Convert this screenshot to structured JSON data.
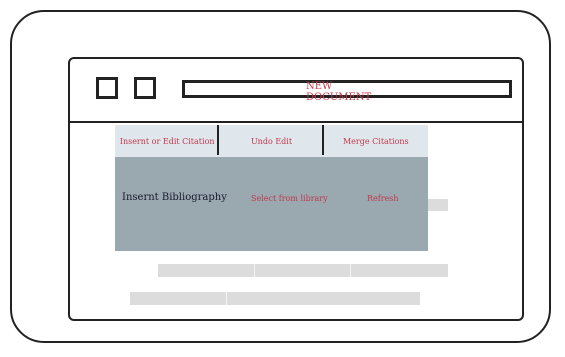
{
  "window": {
    "document_title": "NEW DOCUMENT"
  },
  "menu": {
    "row1": [
      {
        "label": "Insernt or Edit Citation"
      },
      {
        "label": "Undo Edit"
      },
      {
        "label": "Merge Citations"
      }
    ],
    "row2": {
      "insert_bibliography": "Insernt Bibliography",
      "select_from_library": "Select from library",
      "refresh": "Refresh"
    }
  },
  "colors": {
    "accent_text": "#c0394b",
    "menu_top_bg": "#dfe6ec",
    "menu_bottom_bg": "#9aa8b0",
    "placeholder_bar": "#dcdcdc"
  }
}
